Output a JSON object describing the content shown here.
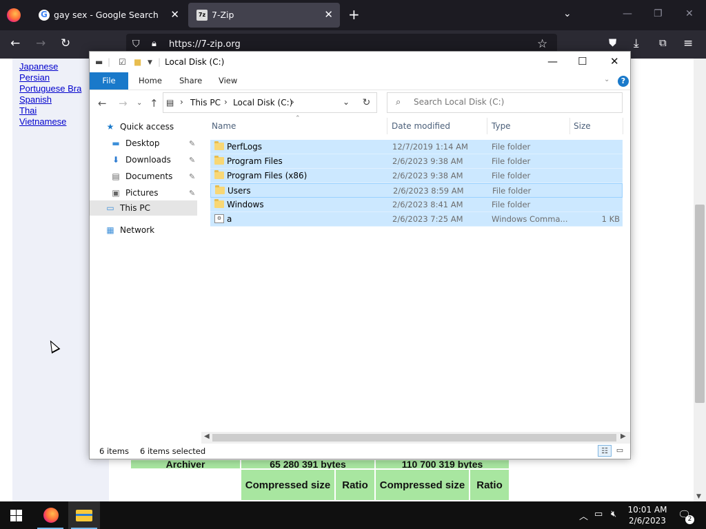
{
  "browser": {
    "tabs": [
      {
        "title": "gay sex - Google Search",
        "favicon": "google-icon"
      },
      {
        "title": "7-Zip",
        "favicon": "7zip-icon",
        "active": true
      }
    ],
    "new_tab": "+",
    "url": "https://7-zip.org"
  },
  "webpage": {
    "languages": [
      "Japanese",
      "Persian",
      "Portuguese Bra",
      "Spanish",
      "Thai",
      "Vietnamese"
    ],
    "table": {
      "row1": [
        "Archiver",
        "65 280 391 bytes",
        "110 700 319 bytes"
      ],
      "row2": [
        "Compressed size",
        "Ratio",
        "Compressed size",
        "Ratio"
      ]
    }
  },
  "explorer": {
    "title": "Local Disk (C:)",
    "ribbon_tabs": [
      "File",
      "Home",
      "Share",
      "View"
    ],
    "breadcrumb": [
      "This PC",
      "Local Disk (C:)"
    ],
    "search_placeholder": "Search Local Disk (C:)",
    "nav": {
      "quick_access": "Quick access",
      "quick_items": [
        "Desktop",
        "Downloads",
        "Documents",
        "Pictures"
      ],
      "this_pc": "This PC",
      "network": "Network"
    },
    "columns": [
      "Name",
      "Date modified",
      "Type",
      "Size"
    ],
    "files": [
      {
        "name": "PerfLogs",
        "date": "12/7/2019 1:14 AM",
        "type": "File folder",
        "size": "",
        "kind": "folder"
      },
      {
        "name": "Program Files",
        "date": "2/6/2023 9:38 AM",
        "type": "File folder",
        "size": "",
        "kind": "folder"
      },
      {
        "name": "Program Files (x86)",
        "date": "2/6/2023 9:38 AM",
        "type": "File folder",
        "size": "",
        "kind": "folder"
      },
      {
        "name": "Users",
        "date": "2/6/2023 8:59 AM",
        "type": "File folder",
        "size": "",
        "kind": "folder"
      },
      {
        "name": "Windows",
        "date": "2/6/2023 8:41 AM",
        "type": "File folder",
        "size": "",
        "kind": "folder"
      },
      {
        "name": "a",
        "date": "2/6/2023 7:25 AM",
        "type": "Windows Comma...",
        "size": "1 KB",
        "kind": "cmd"
      }
    ],
    "status": {
      "items": "6 items",
      "selected": "6 items selected"
    }
  },
  "taskbar": {
    "time": "10:01 AM",
    "date": "2/6/2023",
    "notifications": "2"
  },
  "colors": {
    "selection": "#cce8ff",
    "file_tab": "#1979ca",
    "taskbar": "#101010",
    "browser_chrome": "#1c1b22"
  }
}
